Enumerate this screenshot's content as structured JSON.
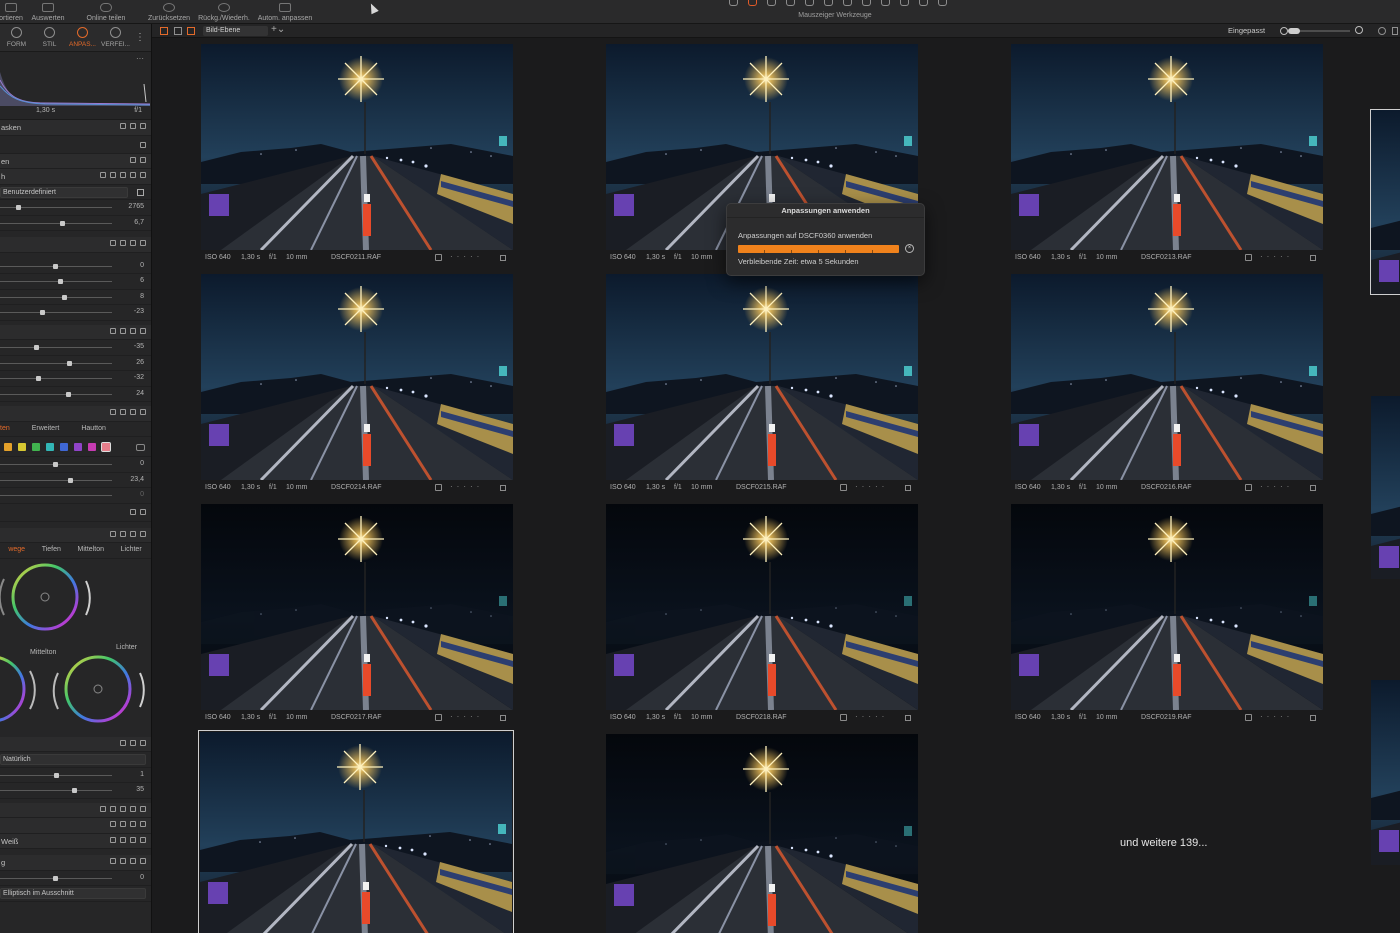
{
  "toolbar": {
    "items": [
      "ortieren",
      "Auswerten",
      "Online teilen",
      "Zurücksetzen",
      "Rückg./Wiederh.",
      "Autom. anpassen"
    ],
    "tool_title": "Mauszeiger Werkzeuge"
  },
  "left_panel": {
    "tabs": [
      "FORM",
      "STIL",
      "ANPAS...",
      "VERFEI..."
    ],
    "active_tab": "ANPAS...",
    "histogram": {
      "shutter": "1,30 s",
      "aperture": "f/1"
    },
    "rows": {
      "masks": "asken",
      "layers": "en",
      "wb_header": "h",
      "wb_mode": "Benutzerdefiniert",
      "kelvin": "2765",
      "tint": "6,7",
      "exposure_vals": [
        "0",
        "6",
        "8",
        "-23"
      ],
      "hdr_vals": [
        "-35",
        "26",
        "-32",
        "24"
      ],
      "color_tabs": [
        "ten",
        "Erweitert",
        "Hautton"
      ],
      "color_vals": [
        "0",
        "23,4",
        "0"
      ],
      "grading_tabs": [
        "wege",
        "Tiefen",
        "Mittelton",
        "Lichter"
      ],
      "grading_wheel_labels": [
        "Mittelton",
        "Lichter"
      ],
      "clarity_mode": "Natürlich",
      "clarity_vals": [
        "1",
        "35"
      ],
      "bw": "Weiß",
      "vignette_header": "g",
      "vignette_val": "0",
      "vignette_mode": "Elliptisch im Ausschnitt"
    }
  },
  "viewer_bar": {
    "layer": "Bild-Ebene",
    "fit": "Eingepasst"
  },
  "thumbnails": [
    {
      "iso": "ISO 640",
      "shutter": "1,30 s",
      "aperture": "f/1",
      "focal": "10 mm",
      "file": "DSCF0211.RAF"
    },
    {
      "iso": "ISO 640",
      "shutter": "1,30 s",
      "aperture": "f/1",
      "focal": "10 mm",
      "file": ""
    },
    {
      "iso": "ISO 640",
      "shutter": "1,30 s",
      "aperture": "f/1",
      "focal": "10 mm",
      "file": "DSCF0213.RAF"
    },
    {
      "iso": "ISO 640",
      "shutter": "1,30 s",
      "aperture": "f/1",
      "focal": "10 mm",
      "file": "DSCF0214.RAF"
    },
    {
      "iso": "ISO 640",
      "shutter": "1,30 s",
      "aperture": "f/1",
      "focal": "10 mm",
      "file": "DSCF0215.RAF"
    },
    {
      "iso": "ISO 640",
      "shutter": "1,30 s",
      "aperture": "f/1",
      "focal": "10 mm",
      "file": "DSCF0216.RAF"
    },
    {
      "iso": "ISO 640",
      "shutter": "1,30 s",
      "aperture": "f/1",
      "focal": "10 mm",
      "file": "DSCF0217.RAF"
    },
    {
      "iso": "ISO 640",
      "shutter": "1,30 s",
      "aperture": "f/1",
      "focal": "10 mm",
      "file": "DSCF0218.RAF"
    },
    {
      "iso": "ISO 640",
      "shutter": "1,30 s",
      "aperture": "f/1",
      "focal": "10 mm",
      "file": "DSCF0219.RAF"
    }
  ],
  "more_label": "und weitere 139...",
  "dialog": {
    "title": "Anpassungen anwenden",
    "line1": "Anpassungen auf  DSCF0360 anwenden",
    "progress": 1.0,
    "line2": "Verbleibende Zeit: etwa 5 Sekunden"
  },
  "colors": {
    "accent": "#e36a2a",
    "progress": "#f0821c"
  }
}
